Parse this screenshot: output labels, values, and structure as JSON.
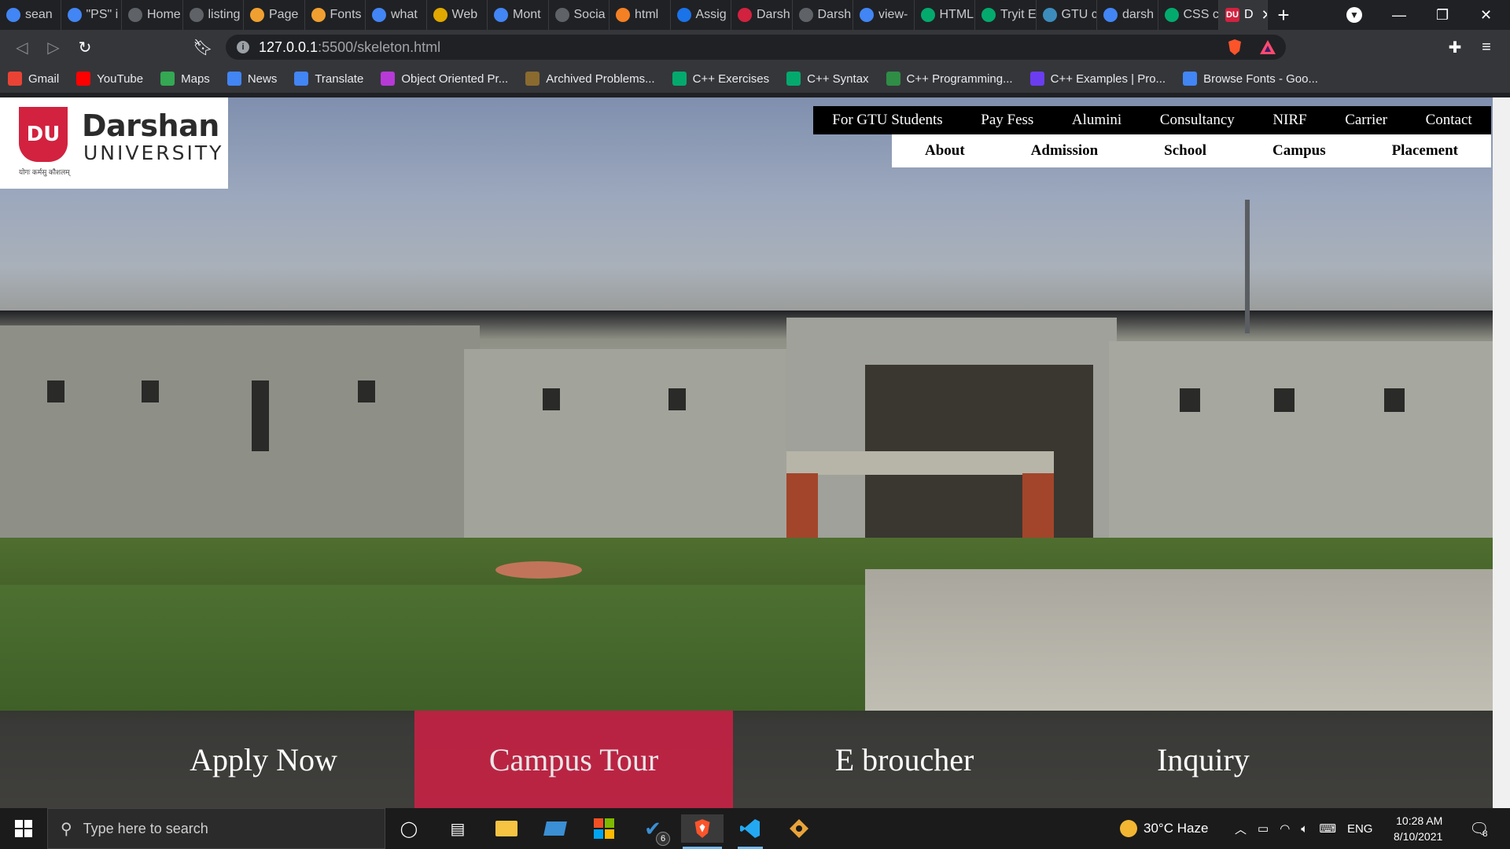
{
  "browser": {
    "tabs": [
      {
        "label": "sean",
        "icon": "google-icon",
        "color": "#4285f4"
      },
      {
        "label": "\"PS\" i",
        "icon": "google-icon",
        "color": "#4285f4"
      },
      {
        "label": "Home",
        "icon": "globe-icon",
        "color": "#5f6368"
      },
      {
        "label": "listing",
        "icon": "globe-icon",
        "color": "#5f6368"
      },
      {
        "label": "Page",
        "icon": "page-icon",
        "color": "#f0a030"
      },
      {
        "label": "Fonts",
        "icon": "page-icon",
        "color": "#f0a030"
      },
      {
        "label": "what",
        "icon": "google-icon",
        "color": "#4285f4"
      },
      {
        "label": "Web",
        "icon": "web-icon",
        "color": "#e0a800"
      },
      {
        "label": "Mont",
        "icon": "fonts-icon",
        "color": "#4285f4"
      },
      {
        "label": "Socia",
        "icon": "globe-icon",
        "color": "#5f6368"
      },
      {
        "label": "html",
        "icon": "stackoverflow-icon",
        "color": "#f48024"
      },
      {
        "label": "Assig",
        "icon": "d-icon",
        "color": "#1a73e8"
      },
      {
        "label": "Darsh",
        "icon": "du-icon",
        "color": "#d2223f"
      },
      {
        "label": "Darsh",
        "icon": "globe-icon",
        "color": "#5f6368"
      },
      {
        "label": "view-",
        "icon": "doc-icon",
        "color": "#4285f4"
      },
      {
        "label": "HTML",
        "icon": "w3-icon",
        "color": "#04aa6d"
      },
      {
        "label": "Tryit E",
        "icon": "w3-icon",
        "color": "#04aa6d"
      },
      {
        "label": "GTU c",
        "icon": "gtu-icon",
        "color": "#3c8dbc"
      },
      {
        "label": "darsh",
        "icon": "google-icon",
        "color": "#4285f4"
      },
      {
        "label": "CSS c",
        "icon": "w3-icon",
        "color": "#04aa6d"
      }
    ],
    "active_tab": {
      "label": "D",
      "icon": "du-icon",
      "color": "#d2223f"
    },
    "address": {
      "host": "127.0.0.1",
      "path": ":5500/skeleton.html"
    },
    "bookmarks": [
      {
        "label": "Gmail",
        "icon": "gmail-icon",
        "color": "#ea4335"
      },
      {
        "label": "YouTube",
        "icon": "youtube-icon",
        "color": "#ff0000"
      },
      {
        "label": "Maps",
        "icon": "maps-icon",
        "color": "#34a853"
      },
      {
        "label": "News",
        "icon": "news-icon",
        "color": "#4285f4"
      },
      {
        "label": "Translate",
        "icon": "translate-icon",
        "color": "#4285f4"
      },
      {
        "label": "Object Oriented Pr...",
        "icon": "m-icon",
        "color": "#b73ad6"
      },
      {
        "label": "Archived Problems...",
        "icon": "pe-icon",
        "color": "#8a6a2f"
      },
      {
        "label": "C++ Exercises",
        "icon": "w3-icon",
        "color": "#04aa6d"
      },
      {
        "label": "C++ Syntax",
        "icon": "w3-icon",
        "color": "#04aa6d"
      },
      {
        "label": "C++ Programming...",
        "icon": "gfg-icon",
        "color": "#2f8d46"
      },
      {
        "label": "C++ Examples | Pro...",
        "icon": "programiz-icon",
        "color": "#6b3df0"
      },
      {
        "label": "Browse Fonts - Goo...",
        "icon": "fonts-icon",
        "color": "#4285f4"
      }
    ]
  },
  "site": {
    "logo": {
      "mark": "DU",
      "name": "Darshan",
      "sub": "UNIVERSITY",
      "tagline": "योगः कर्मसु कौशलम्"
    },
    "top_nav": [
      "For GTU Students",
      "Pay Fess",
      "Alumini",
      "Consultancy",
      "NIRF",
      "Carrier",
      "Contact"
    ],
    "sub_nav": [
      "About",
      "Admission",
      "School",
      "Campus",
      "Placement"
    ],
    "cta": [
      {
        "label": "Apply Now",
        "color": "#ffffff"
      },
      {
        "label": "Campus Tour",
        "color": "#e8e8e8",
        "active": true
      },
      {
        "label": "E broucher",
        "color": "#ffffff"
      },
      {
        "label": "Inquiry",
        "color": "#ffffff"
      }
    ],
    "accent": "#d2223f"
  },
  "taskbar": {
    "search_placeholder": "Type here to search",
    "weather": "30°C  Haze",
    "language": "ENG",
    "time": "10:28 AM",
    "date": "8/10/2021",
    "notifications": "8",
    "todo_badge": "6"
  }
}
